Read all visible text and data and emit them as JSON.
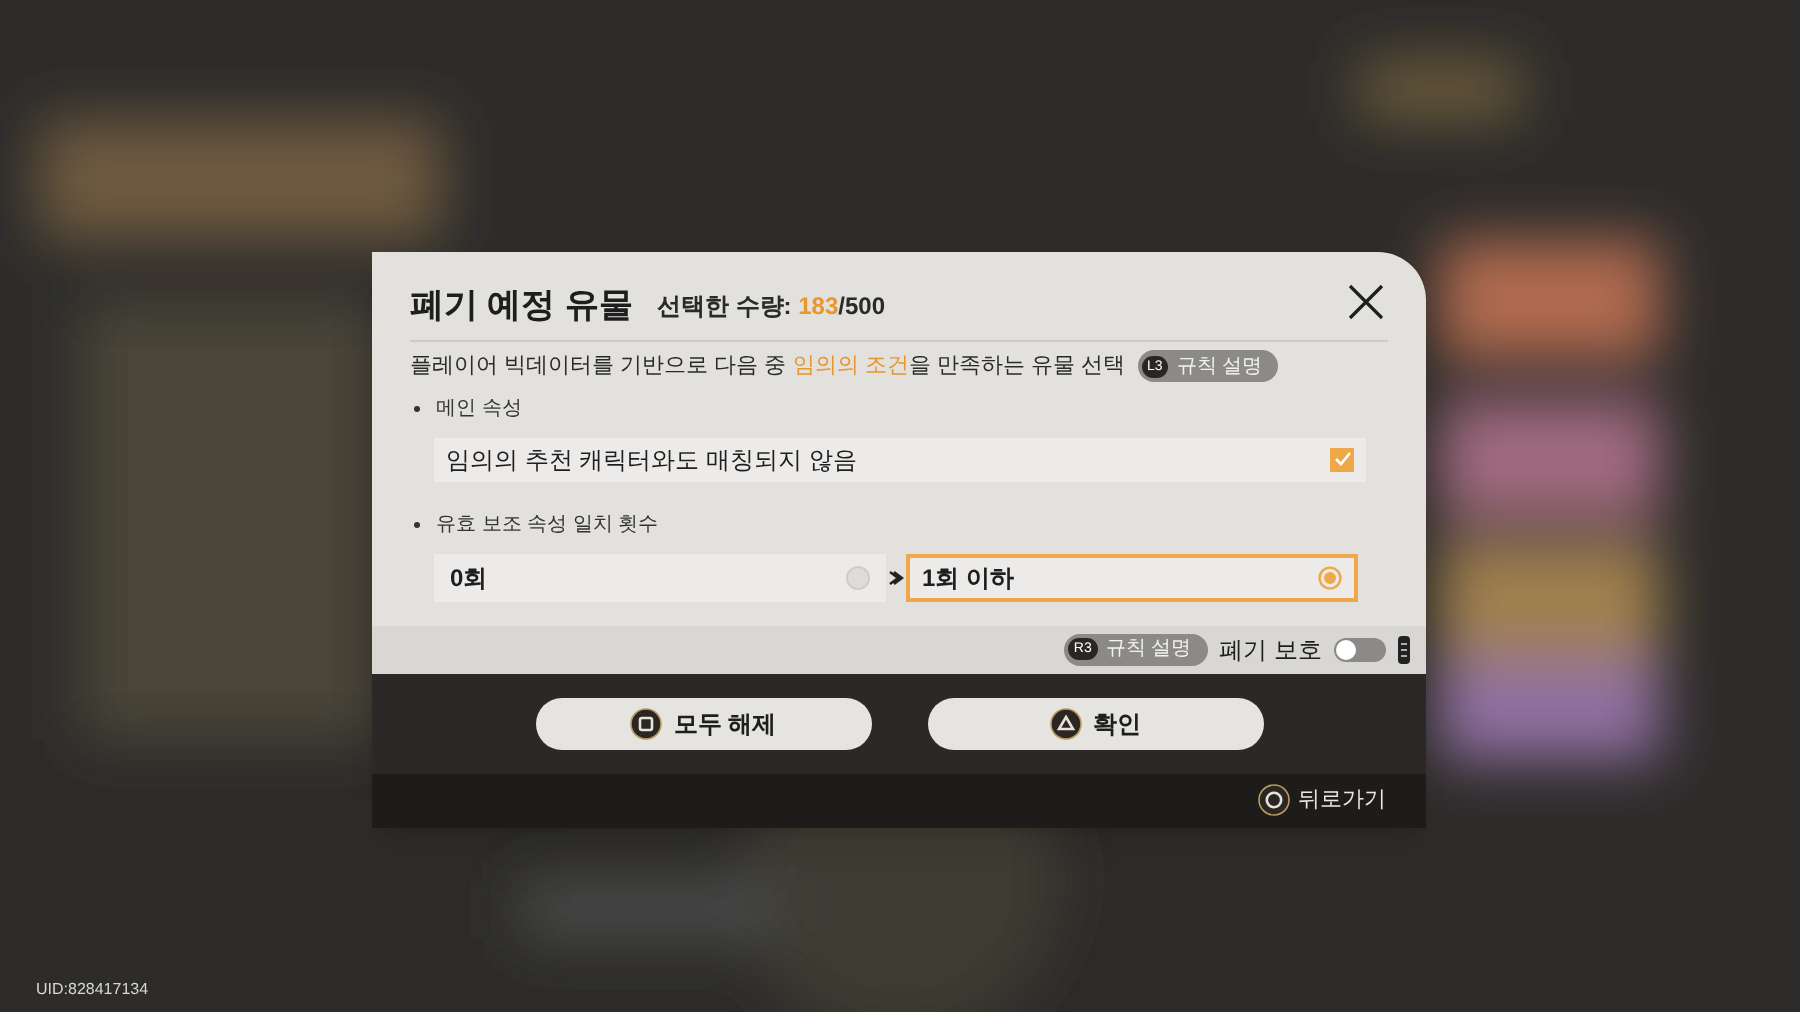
{
  "dialog": {
    "title": "폐기 예정 유물",
    "count": [
      {
        "text": "선택한 수량: ",
        "highlight": false
      },
      {
        "text": "183",
        "highlight": true
      },
      {
        "text": "/500",
        "highlight": false
      }
    ],
    "description": [
      {
        "text": "플레이어 빅데이터를 기반으로 다음 중 ",
        "highlight": false
      },
      {
        "text": "임의의 조건",
        "highlight": true
      },
      {
        "text": "을 만족하는 유물 선택",
        "highlight": false
      }
    ],
    "rules_button": {
      "key": "L3",
      "label": "규칙 설명"
    },
    "main_stat": {
      "heading": "메인 속성",
      "option": {
        "label": "임의의 추천 캐릭터와도 매칭되지 않음",
        "checked": true
      }
    },
    "substat": {
      "heading": "유효 보조 속성 일치 횟수",
      "options": [
        {
          "label": "0회",
          "selected": false
        },
        {
          "label": "1회 이하",
          "selected": true
        }
      ]
    },
    "footer_rules_button": {
      "key": "R3",
      "label": "규칙 설명"
    },
    "protect_toggle": {
      "label": "폐기 보호",
      "on": false
    },
    "buttons": [
      {
        "kind": "square",
        "label": "모두 해제"
      },
      {
        "kind": "triangle",
        "label": "확인"
      }
    ],
    "back": {
      "label": "뒤로가기"
    }
  },
  "uid": "UID:828417134"
}
